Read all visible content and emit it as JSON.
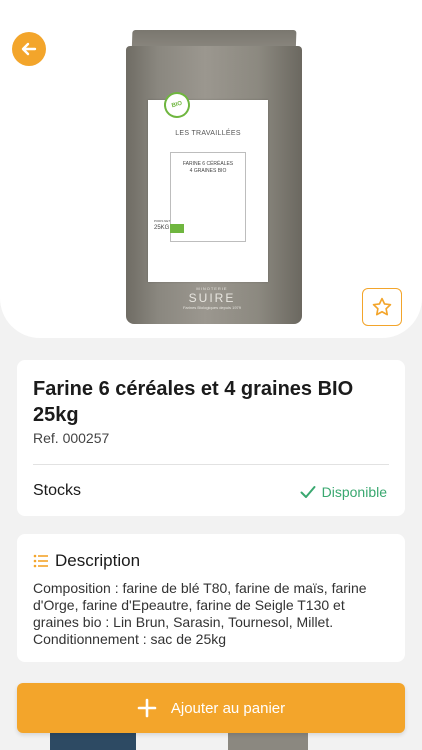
{
  "product": {
    "title": "Farine 6 céréales et 4 graines BIO 25kg",
    "ref": "Ref. 000257",
    "image_label": {
      "brand": "LES TRAVAILLÉES",
      "product_line1": "FARINE 6 CÉRÉALES",
      "product_line2": "4 GRAINES BIO",
      "weight_caption": "POIDS NET",
      "weight": "25KG",
      "bio_seal": "BIO",
      "maker_small": "MINOTERIE",
      "maker": "SUIRE",
      "maker_tagline": "Farines Biologiques depuis 1979"
    }
  },
  "stocks": {
    "label": "Stocks",
    "status": "Disponible"
  },
  "description": {
    "title": "Description",
    "text": "Composition : farine de blé T80, farine de maïs, farine d'Orge, farine d'Epeautre, farine de Seigle T130 et graines bio : Lin Brun, Sarasin, Tournesol, Millet. Conditionnement : sac de 25kg"
  },
  "actions": {
    "add_to_cart": "Ajouter au panier"
  },
  "colors": {
    "accent": "#f3a52b",
    "success": "#3aa870",
    "background": "#f2f2f2"
  },
  "icons": {
    "back": "arrow-left-icon",
    "favorite": "star-outline-icon",
    "stock": "check-icon",
    "description": "list-icon",
    "add": "plus-icon"
  }
}
